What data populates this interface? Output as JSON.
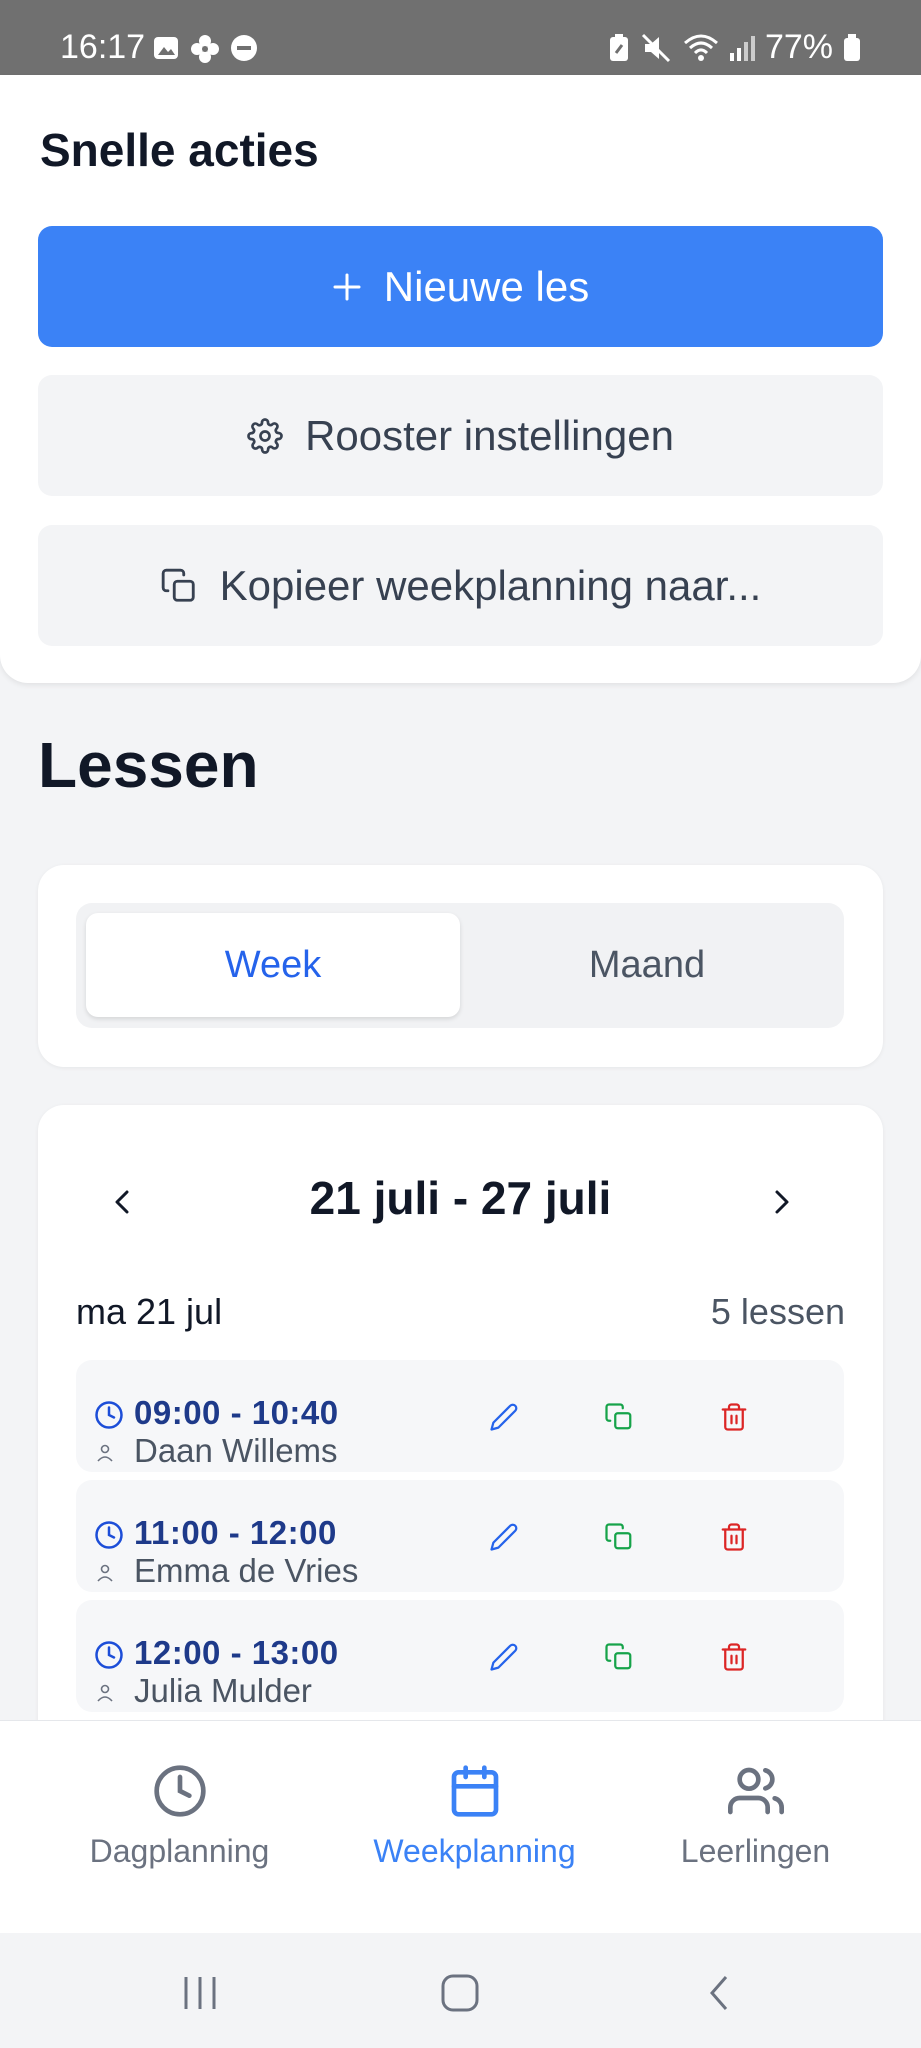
{
  "status_bar": {
    "time": "16:17",
    "battery": "77%"
  },
  "quick_actions": {
    "title": "Snelle acties",
    "new_lesson": "Nieuwe les",
    "schedule_settings": "Rooster instellingen",
    "copy_week": "Kopieer weekplanning naar..."
  },
  "lessons": {
    "title": "Lessen",
    "view_toggle": {
      "week": "Week",
      "month": "Maand",
      "selected": "Week"
    },
    "range": "21 juli - 27 juli",
    "day": {
      "label": "ma 21 jul",
      "count": "5 lessen",
      "items": [
        {
          "time": "09:00 - 10:40",
          "student": "Daan Willems"
        },
        {
          "time": "11:00 - 12:00",
          "student": "Emma de Vries"
        },
        {
          "time": "12:00 - 13:00",
          "student": "Julia Mulder"
        }
      ]
    }
  },
  "bottom_nav": {
    "items": [
      {
        "label": "Dagplanning",
        "icon": "clock-icon"
      },
      {
        "label": "Weekplanning",
        "icon": "calendar-icon",
        "active": true
      },
      {
        "label": "Leerlingen",
        "icon": "users-icon"
      }
    ]
  },
  "colors": {
    "primary": "#3b82f6",
    "edit": "#2563eb",
    "copy": "#16a34a",
    "delete": "#dc2626"
  }
}
